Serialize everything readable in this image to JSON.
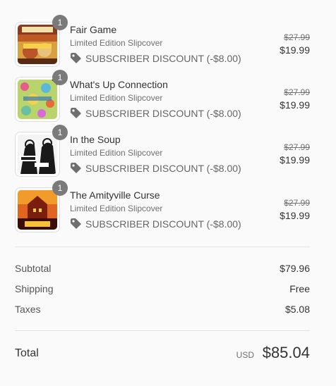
{
  "items": [
    {
      "quantity": "1",
      "title": "Fair Game",
      "variant": "Limited Edition Slipcover",
      "discount": "SUBSCRIBER DISCOUNT (-$8.00)",
      "original_price": "$27.99",
      "price": "$19.99",
      "thumbnail": "fair-game-cover"
    },
    {
      "quantity": "1",
      "title": "What's Up Connection",
      "variant": "Limited Edition Slipcover",
      "discount": "SUBSCRIBER DISCOUNT (-$8.00)",
      "original_price": "$27.99",
      "price": "$19.99",
      "thumbnail": "whats-up-connection-cover"
    },
    {
      "quantity": "1",
      "title": "In the Soup",
      "variant": "Limited Edition Slipcover",
      "discount": "SUBSCRIBER DISCOUNT (-$8.00)",
      "original_price": "$27.99",
      "price": "$19.99",
      "thumbnail": "in-the-soup-cover"
    },
    {
      "quantity": "1",
      "title": "The Amityville Curse",
      "variant": "Limited Edition Slipcover",
      "discount": "SUBSCRIBER DISCOUNT (-$8.00)",
      "original_price": "$27.99",
      "price": "$19.99",
      "thumbnail": "amityville-curse-cover"
    }
  ],
  "summary": {
    "subtotal_label": "Subtotal",
    "subtotal_value": "$79.96",
    "shipping_label": "Shipping",
    "shipping_value": "Free",
    "taxes_label": "Taxes",
    "taxes_value": "$5.08"
  },
  "total": {
    "label": "Total",
    "currency": "USD",
    "amount": "$85.04"
  },
  "icons": {
    "discount": "tag-icon"
  },
  "colors": {
    "badge": "#7a7a7a",
    "text": "#333333",
    "muted": "#707070",
    "background": "#fafafa"
  }
}
